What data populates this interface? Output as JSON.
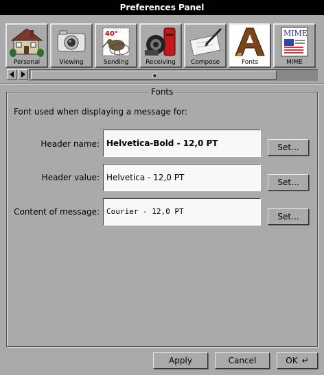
{
  "window": {
    "title": "Preferences Panel"
  },
  "tabs": [
    {
      "label": "Personal",
      "icon": "house-icon",
      "active": false
    },
    {
      "label": "Viewing",
      "icon": "camera-icon",
      "active": false
    },
    {
      "label": "Sending",
      "icon": "stamp-kiwi-icon",
      "active": false
    },
    {
      "label": "Receiving",
      "icon": "mailbox-icon",
      "active": false
    },
    {
      "label": "Compose",
      "icon": "pen-letter-icon",
      "active": false
    },
    {
      "label": "Fonts",
      "icon": "font-a-icon",
      "active": true
    },
    {
      "label": "MIME",
      "icon": "mime-document-icon",
      "active": false
    }
  ],
  "stamp_text": "40°",
  "mime_text": "MIME",
  "fonts_panel": {
    "group_title": "Fonts",
    "intro": "Font used when displaying a message for:",
    "rows": [
      {
        "label": "Header name:",
        "value": "Helvetica-Bold - 12,0 PT",
        "button": "Set..."
      },
      {
        "label": "Header value:",
        "value": "Helvetica - 12,0 PT",
        "button": "Set..."
      },
      {
        "label": "Content of message:",
        "value": "Courier - 12,0 PT",
        "button": "Set..."
      }
    ]
  },
  "buttons": {
    "apply": "Apply",
    "cancel": "Cancel",
    "ok": "OK",
    "ok_glyph": "↵"
  },
  "colors": {
    "background": "#aaaaaa",
    "titlebar": "#000000",
    "field": "#f8f8f8"
  }
}
